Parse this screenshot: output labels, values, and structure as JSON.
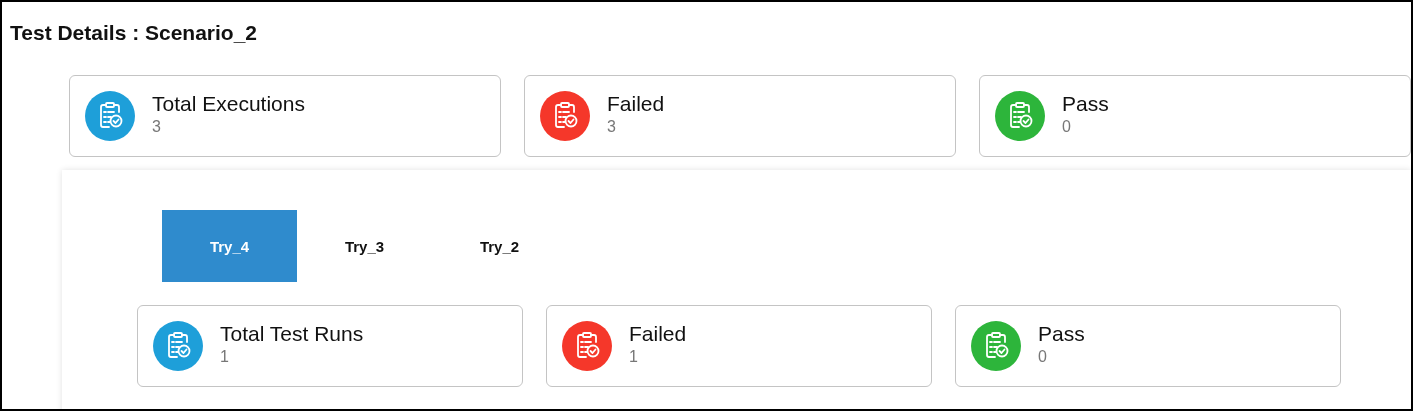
{
  "title": "Test Details : Scenario_2",
  "summary": [
    {
      "label": "Total Executions",
      "value": "3",
      "color": "#1e9fd9"
    },
    {
      "label": "Failed",
      "value": "3",
      "color": "#f5372a"
    },
    {
      "label": "Pass",
      "value": "0",
      "color": "#2db53b"
    }
  ],
  "tabs": [
    {
      "label": "Try_4",
      "selected": true
    },
    {
      "label": "Try_3",
      "selected": false
    },
    {
      "label": "Try_2",
      "selected": false
    }
  ],
  "try_summary": [
    {
      "label": "Total Test Runs",
      "value": "1",
      "color": "#1e9fd9"
    },
    {
      "label": "Failed",
      "value": "1",
      "color": "#f5372a"
    },
    {
      "label": "Pass",
      "value": "0",
      "color": "#2db53b"
    }
  ]
}
